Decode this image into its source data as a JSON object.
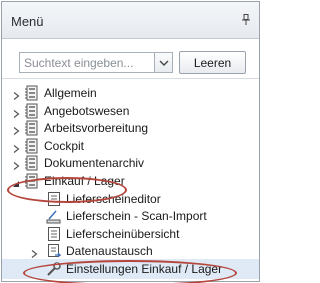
{
  "panel": {
    "title": "Menü",
    "pin_icon": "pin-icon"
  },
  "search": {
    "placeholder": "Suchtext eingeben...",
    "value": "",
    "dropdown_icon": "chevron-down-icon",
    "clear_label": "Leeren"
  },
  "tree": {
    "items": [
      {
        "label": "Allgemein",
        "icon": "folder-icon",
        "expandable": true,
        "level": 0
      },
      {
        "label": "Angebotswesen",
        "icon": "folder-icon",
        "expandable": true,
        "level": 0
      },
      {
        "label": "Arbeitsvorbereitung",
        "icon": "folder-icon",
        "expandable": true,
        "level": 0
      },
      {
        "label": "Cockpit",
        "icon": "folder-icon",
        "expandable": true,
        "level": 0
      },
      {
        "label": "Dokumentenarchiv",
        "icon": "folder-icon",
        "expandable": true,
        "level": 0
      },
      {
        "label": "Einkauf / Lager",
        "icon": "folder-icon",
        "expandable": true,
        "expanded": true,
        "level": 0,
        "annotated": true
      },
      {
        "label": "Lieferscheineditor",
        "icon": "document-list-icon",
        "expandable": false,
        "level": 1
      },
      {
        "label": "Lieferschein - Scan-Import",
        "icon": "scanner-icon",
        "expandable": false,
        "level": 1
      },
      {
        "label": "Lieferscheinübersicht",
        "icon": "document-list-icon",
        "expandable": false,
        "level": 1
      },
      {
        "label": "Datenaustausch",
        "icon": "data-exchange-icon",
        "expandable": true,
        "level": 1
      },
      {
        "label": "Einstellungen Einkauf / Lager",
        "icon": "settings-icon",
        "expandable": false,
        "level": 1,
        "selected": true,
        "annotated": true
      }
    ]
  },
  "colors": {
    "annotation": "#b4463c",
    "selection": "#dfeaf6",
    "border": "#9aa3ad"
  }
}
